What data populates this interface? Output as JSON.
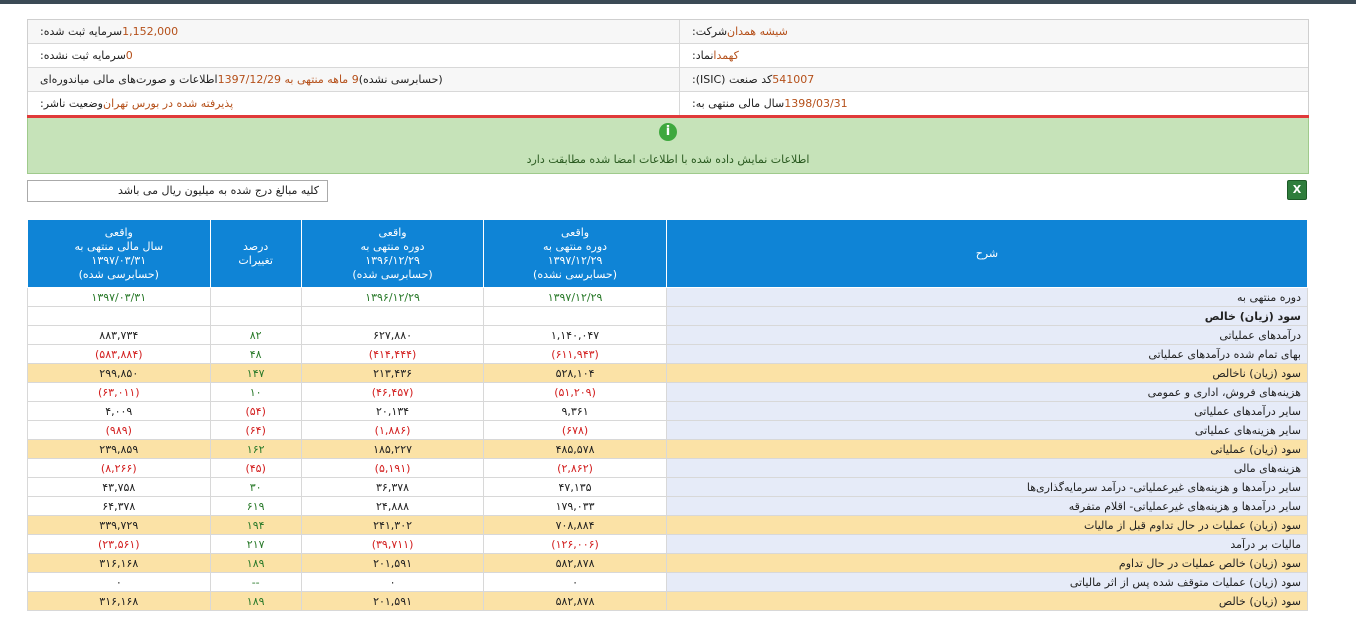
{
  "info": {
    "rows": [
      {
        "right_label": "شرکت:",
        "right_value": "شیشه همدان",
        "left_label": "سرمایه ثبت شده:",
        "left_value": "1,152,000",
        "left_suffix": ""
      },
      {
        "right_label": "نماد:",
        "right_value": "کهمدا",
        "left_label": "سرمایه ثبت نشده:",
        "left_value": "0",
        "left_suffix": ""
      },
      {
        "right_label": "کد صنعت (ISIC):",
        "right_value": "541007",
        "left_label": "اطلاعات و صورت‌های مالی میاندوره‌ای",
        "left_value": "9 ماهه منتهی به 1397/12/29",
        "left_suffix": "(حسابرسی نشده)"
      },
      {
        "right_label": "سال مالی منتهی به:",
        "right_value": "1398/03/31",
        "left_label": "وضعیت ناشر:",
        "left_value": "پذیرفته شده در بورس تهران",
        "left_suffix": ""
      }
    ]
  },
  "alert": {
    "text": "اطلاعات نمایش داده شده با اطلاعات امضا شده مطابقت دارد",
    "icon": "info-icon",
    "color": "#c6e3b9"
  },
  "units_note": "کلیه مبالغ درج شده به میلیون ریال می باشد",
  "export_icon": "excel-icon",
  "table": {
    "headers": {
      "desc": "شرح",
      "col1": [
        "واقعی",
        "دوره منتهی به",
        "۱۳۹۷/۱۲/۲۹",
        "(حسابرسی نشده)"
      ],
      "col2": [
        "واقعی",
        "دوره منتهی به",
        "۱۳۹۶/۱۲/۲۹",
        "(حسابرسی شده)"
      ],
      "col3": [
        "درصد",
        "تغییرات"
      ],
      "col4": [
        "واقعی",
        "سال مالی منتهی به",
        "۱۳۹۷/۰۳/۳۱",
        "(حسابرسی شده)"
      ]
    },
    "rows": [
      {
        "desc": "دوره منتهی به",
        "c1": "۱۳۹۷/۱۲/۲۹",
        "c2": "۱۳۹۶/۱۲/۲۹",
        "c3": "",
        "c4": "۱۳۹۷/۰۳/۳۱",
        "hl": false,
        "green": true
      },
      {
        "desc": "سود (زیان) خالص",
        "c1": "",
        "c2": "",
        "c3": "",
        "c4": "",
        "hl": false,
        "bold": true
      },
      {
        "desc": "درآمدهای عملیاتی",
        "c1": "۱,۱۴۰,۰۴۷",
        "c2": "۶۲۷,۸۸۰",
        "c3": "۸۲",
        "c4": "۸۸۳,۷۳۴",
        "hl": false
      },
      {
        "desc": "بهای تمام شده درآمدهای عملیاتی",
        "c1": "(۶۱۱,۹۴۳)",
        "c2": "(۴۱۴,۴۴۴)",
        "c3": "۴۸",
        "c4": "(۵۸۳,۸۸۴)",
        "hl": false
      },
      {
        "desc": "سود (زیان) ناخالص",
        "c1": "۵۲۸,۱۰۴",
        "c2": "۲۱۳,۴۳۶",
        "c3": "۱۴۷",
        "c4": "۲۹۹,۸۵۰",
        "hl": true
      },
      {
        "desc": "هزینه‌های فروش، اداری و عمومی",
        "c1": "(۵۱,۲۰۹)",
        "c2": "(۴۶,۴۵۷)",
        "c3": "۱۰",
        "c4": "(۶۳,۰۱۱)",
        "hl": false
      },
      {
        "desc": "سایر درآمدهای عملیاتی",
        "c1": "۹,۳۶۱",
        "c2": "۲۰,۱۳۴",
        "c3": "(۵۴)",
        "c4": "۴,۰۰۹",
        "hl": false
      },
      {
        "desc": "سایر هزینه‌های عملیاتی",
        "c1": "(۶۷۸)",
        "c2": "(۱,۸۸۶)",
        "c3": "(۶۴)",
        "c4": "(۹۸۹)",
        "hl": false
      },
      {
        "desc": "سود (زیان) عملیاتی",
        "c1": "۴۸۵,۵۷۸",
        "c2": "۱۸۵,۲۲۷",
        "c3": "۱۶۲",
        "c4": "۲۳۹,۸۵۹",
        "hl": true
      },
      {
        "desc": "هزینه‌های مالی",
        "c1": "(۲,۸۶۲)",
        "c2": "(۵,۱۹۱)",
        "c3": "(۴۵)",
        "c4": "(۸,۲۶۶)",
        "hl": false
      },
      {
        "desc": "سایر درآمدها و هزینه‌های غیرعملیاتی- درآمد سرمایه‌گذاری‌ها",
        "c1": "۴۷,۱۳۵",
        "c2": "۳۶,۳۷۸",
        "c3": "۳۰",
        "c4": "۴۳,۷۵۸",
        "hl": false
      },
      {
        "desc": "سایر درآمدها و هزینه‌های غیرعملیاتی- اقلام متفرقه",
        "c1": "۱۷۹,۰۳۳",
        "c2": "۲۴,۸۸۸",
        "c3": "۶۱۹",
        "c4": "۶۴,۳۷۸",
        "hl": false
      },
      {
        "desc": "سود (زیان) عملیات در حال تداوم قبل از مالیات",
        "c1": "۷۰۸,۸۸۴",
        "c2": "۲۴۱,۳۰۲",
        "c3": "۱۹۴",
        "c4": "۳۳۹,۷۲۹",
        "hl": true
      },
      {
        "desc": "مالیات بر درآمد",
        "c1": "(۱۲۶,۰۰۶)",
        "c2": "(۳۹,۷۱۱)",
        "c3": "۲۱۷",
        "c4": "(۲۳,۵۶۱)",
        "hl": false
      },
      {
        "desc": "سود (زیان) خالص عملیات در حال تداوم",
        "c1": "۵۸۲,۸۷۸",
        "c2": "۲۰۱,۵۹۱",
        "c3": "۱۸۹",
        "c4": "۳۱۶,۱۶۸",
        "hl": true
      },
      {
        "desc": "سود (زیان) عملیات متوقف شده پس از اثر مالیاتی",
        "c1": "۰",
        "c2": "۰",
        "c3": "--",
        "c4": "۰",
        "hl": false
      },
      {
        "desc": "سود (زیان) خالص",
        "c1": "۵۸۲,۸۷۸",
        "c2": "۲۰۱,۵۹۱",
        "c3": "۱۸۹",
        "c4": "۳۱۶,۱۶۸",
        "hl": true
      }
    ]
  }
}
